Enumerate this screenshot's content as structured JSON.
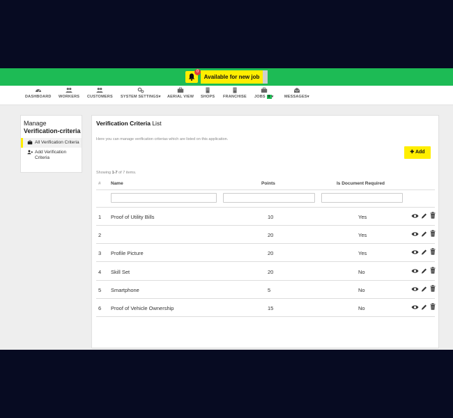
{
  "notifications": {
    "count": "0",
    "available_label": "Available for new job"
  },
  "nav": {
    "items": [
      {
        "label": "DASHBOARD",
        "icon": "dashboard-icon"
      },
      {
        "label": "WORKERS",
        "icon": "users-icon"
      },
      {
        "label": "CUSTOMERS",
        "icon": "users-icon"
      },
      {
        "label": "SYSTEM SETTINGS",
        "icon": "cogs-icon",
        "dropdown": true
      },
      {
        "label": "AERIAL VIEW",
        "icon": "briefcase-icon"
      },
      {
        "label": "SHOPS",
        "icon": "building-icon"
      },
      {
        "label": "FRANCHISE",
        "icon": "building-icon"
      },
      {
        "label": "JOBS",
        "icon": "briefcase-icon",
        "badge": "0",
        "dropdown": true
      },
      {
        "label": "MESSAGES",
        "icon": "envelope-icon",
        "dropdown": true
      }
    ]
  },
  "sidebar": {
    "manage": "Manage",
    "title": "Verification-criteria",
    "items": [
      {
        "label": "All Verification Criteria",
        "icon": "briefcase-icon",
        "active": true
      },
      {
        "label": "Add Verification Criteria",
        "icon": "user-plus-icon",
        "active": false
      }
    ]
  },
  "page": {
    "title_bold": "Verification Criteria",
    "title_rest": "List",
    "description": "Here you can manage verification criterias which are listed on this application.",
    "add_label": "Add",
    "summary_prefix": "Showing ",
    "summary_range": "1-7",
    "summary_suffix": " of 7 items."
  },
  "table": {
    "columns": [
      "#",
      "Name",
      "Points",
      "Is Document Required"
    ],
    "rows": [
      {
        "num": "1",
        "name": "Proof of Utility Bills",
        "points": "10",
        "doc": "Yes"
      },
      {
        "num": "2",
        "name": "",
        "points": "20",
        "doc": "Yes"
      },
      {
        "num": "3",
        "name": "Profile Picture",
        "points": "20",
        "doc": "Yes"
      },
      {
        "num": "4",
        "name": "Skill Set",
        "points": "20",
        "doc": "No"
      },
      {
        "num": "5",
        "name": "Smartphone",
        "points": "5",
        "doc": "No"
      },
      {
        "num": "6",
        "name": "Proof of Vehicle Ownership",
        "points": "15",
        "doc": "No"
      }
    ]
  },
  "colors": {
    "topbar": "#1dbb55",
    "accent": "#ffee00",
    "badge": "#e23c3c",
    "page_bg": "#070b22"
  }
}
